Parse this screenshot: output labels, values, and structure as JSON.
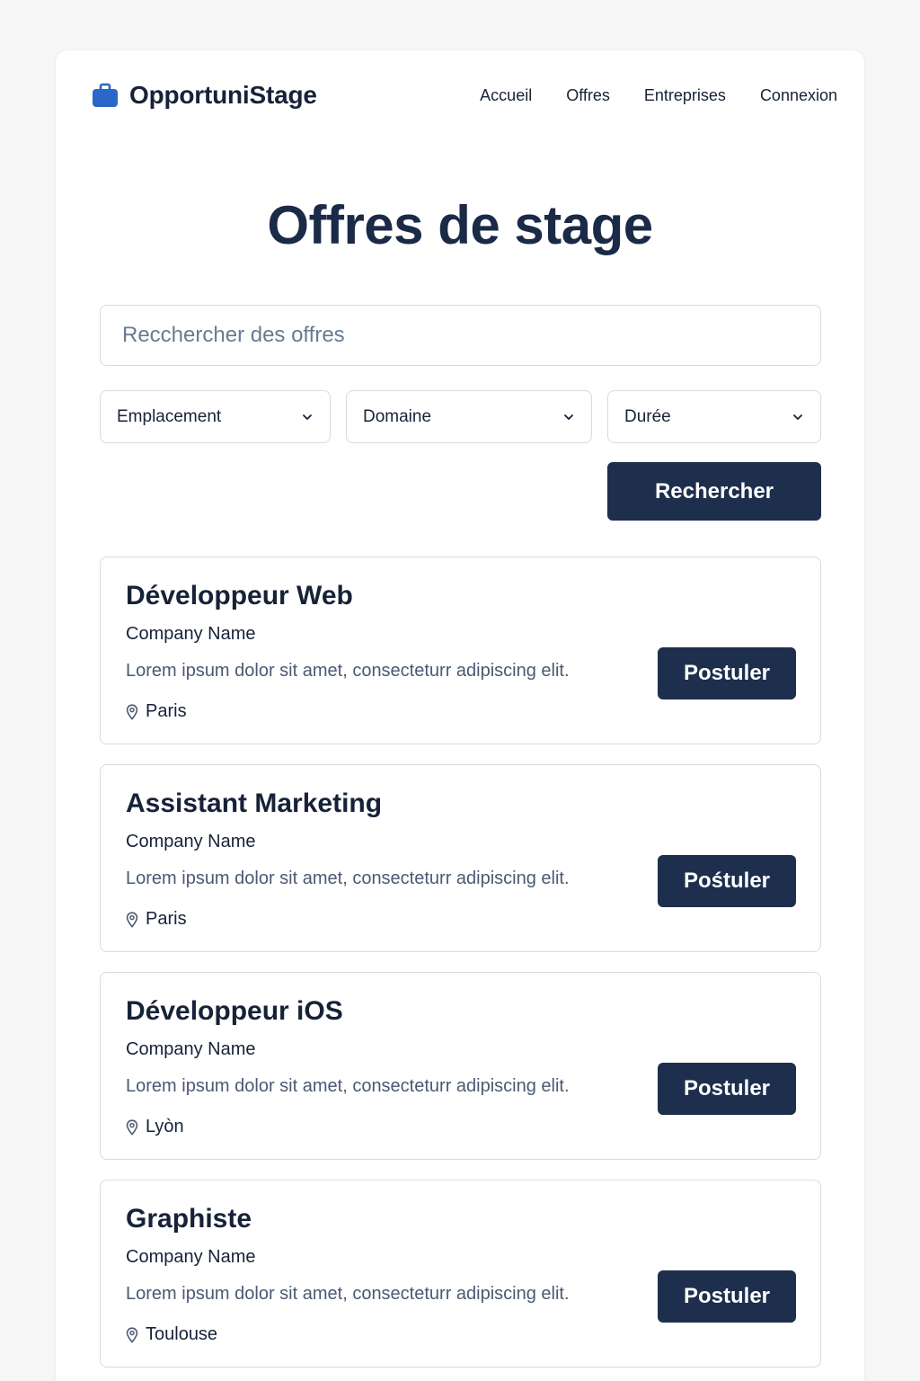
{
  "colors": {
    "brand": "#2a67c9",
    "primary_button": "#1d2f4c",
    "heading": "#1a2a47",
    "background": "#f6f6f7"
  },
  "header": {
    "logo_icon": "briefcase-icon",
    "app_name": "OpportuniStage",
    "nav": [
      {
        "label": "Accueil"
      },
      {
        "label": "Offres"
      },
      {
        "label": "Entreprises"
      },
      {
        "label": "Connexion"
      }
    ]
  },
  "main": {
    "title": "Offres de stage",
    "search": {
      "placeholder": "Recchercher des offres",
      "value": ""
    },
    "filters": [
      {
        "label": "Emplacement",
        "icon": "chevron-down-icon"
      },
      {
        "label": "Domaine",
        "icon": "chevron-down-icon"
      },
      {
        "label": "Durée",
        "icon": "chevron-down-icon"
      }
    ],
    "search_button": "Rechercher"
  },
  "offers": [
    {
      "title": "Développeur Web",
      "company": "Company Name",
      "description": "Lorem ipsum dolor sit amet,  consecteturr  adipiscing  elit.",
      "location": "Paris",
      "location_icon": "map-pin-icon",
      "apply_label": "Postuler"
    },
    {
      "title": "Assistant Marketing",
      "company": "Company Name",
      "description": "Lorem ipsum dolor sit amet,  consecteturr  adipiscing  elit.",
      "location": "Paris",
      "location_icon": "map-pin-icon",
      "apply_label": "Pośtuler"
    },
    {
      "title": "Développeur iOS",
      "company": "Company Name",
      "description": "Lorem ipsum dolor sit amet,  consecteturr  adipiscing  elit.",
      "location": "Lyòn",
      "location_icon": "map-pin-icon",
      "apply_label": "Postuler"
    },
    {
      "title": "Graphiste",
      "company": "Company Name",
      "description": "Lorem ipsum dolor sit amet,  consecteturr  adipiscing  elit.",
      "location": "Toulouse",
      "location_icon": "map-pin-icon",
      "apply_label": "Postuler"
    }
  ]
}
